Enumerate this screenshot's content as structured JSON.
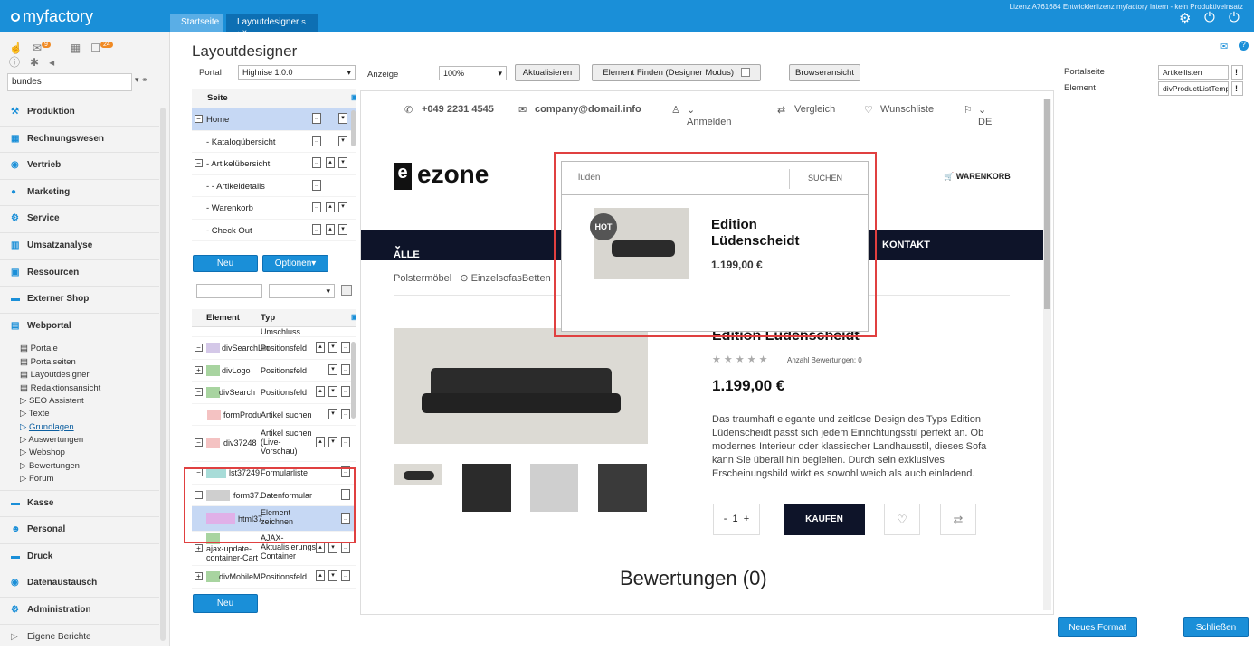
{
  "app": {
    "logo": "myfactory",
    "license": "Lizenz A761684 Entwicklerlizenz myfactory Intern - kein Produktiveinsatz"
  },
  "tabs": [
    {
      "label": "Startseite"
    },
    {
      "label": "Layoutdesigner"
    }
  ],
  "sidebar": {
    "search_value": "bundes",
    "badges": {
      "notes": "9",
      "messages": "24"
    },
    "items": [
      "Produktion",
      "Rechnungswesen",
      "Vertrieb",
      "Marketing",
      "Service",
      "Umsatzanalyse",
      "Ressourcen",
      "Externer Shop",
      "Webportal",
      "Kasse",
      "Personal",
      "Druck",
      "Datenaustausch",
      "Administration",
      "Eigene Berichte"
    ],
    "webportal_sub": [
      "Portale",
      "Portalseiten",
      "Layoutdesigner",
      "Redaktionsansicht",
      "SEO Assistent",
      "Texte",
      "Grundlagen",
      "Auswertungen",
      "Webshop",
      "Bewertungen",
      "Forum"
    ]
  },
  "page": {
    "title": "Layoutdesigner"
  },
  "toolbar": {
    "portal_label": "Portal",
    "portal_value": "Highrise 1.0.0",
    "anzeige_label": "Anzeige",
    "zoom_value": "100%",
    "refresh_label": "Aktualisieren",
    "find_label": "Element Finden (Designer Modus)",
    "browser_label": "Browseransicht"
  },
  "pages_tree": {
    "header": "Seite",
    "rows": [
      "Home",
      "- Katalogübersicht",
      "- Artikelübersicht",
      "- - Artikeldetails",
      "- Warenkorb",
      "- Check Out"
    ]
  },
  "page_buttons": {
    "new": "Neu",
    "options": "Optionen"
  },
  "elements": {
    "col_element": "Element",
    "col_typ": "Typ",
    "rows": [
      {
        "name": "divSearchLin",
        "typ": "Positionsfeld"
      },
      {
        "name": "divLogo",
        "typ": "Positionsfeld"
      },
      {
        "name": "divSearch",
        "typ": "Positionsfeld"
      },
      {
        "name": "formProdu",
        "typ": "Artikel suchen"
      },
      {
        "name": "div37248",
        "typ": "Artikel suchen (Live-Vorschau)"
      },
      {
        "name": "lst37249",
        "typ": "Formularliste"
      },
      {
        "name": "form37.",
        "typ": "Datenformular"
      },
      {
        "name": "html37.",
        "typ": "Element zeichnen"
      },
      {
        "name": "ajax-update-container-Cart",
        "typ": "AJAX-Aktualisierungs Container"
      },
      {
        "name": "divMobileM",
        "typ": "Positionsfeld"
      }
    ],
    "prev_typ": "Umschluss",
    "new": "Neu"
  },
  "properties": {
    "portalseite_label": "Portalseite",
    "portalseite_value": "Artikellisten",
    "element_label": "Element",
    "element_value": "divProductListTemp"
  },
  "preview": {
    "phone": "+049 2231 4545",
    "email": "company@domail.info",
    "login": "Anmelden",
    "compare": "Vergleich",
    "wishlist": "Wunschliste",
    "lang": "DE",
    "brand": "ezone",
    "search_value": "lüden",
    "search_button": "SUCHEN",
    "cart": "WARENKORB",
    "nav_cat": "ALLE KATEGORIEN",
    "nav_contact": "KONTAKT",
    "breadcrumb": [
      "Polstermöbel",
      "EinzelsofasBetten"
    ],
    "result": {
      "badge": "HOT",
      "name": "Edition Lüdenscheidt",
      "price": "1.199,00 €"
    },
    "product": {
      "title": "Edition Lüdenscheidt",
      "rating_label": "Anzahl Bewertungen: 0",
      "price": "1.199,00  €",
      "description": "Das traumhaft elegante und zeitlose Design des Typs Edition Lüdenscheidt passt sich jedem Einrichtungsstil perfekt an. Ob modernes Interieur oder klassischer Landhausstil, dieses Sofa kann Sie überall hin begleiten. Durch sein exklusives Erscheinungsbild wirkt es sowohl weich als auch einladend.",
      "qty": "1",
      "buy": "KAUFEN",
      "reviews": "Bewertungen (0)"
    }
  },
  "footer": {
    "new_format": "Neues Format",
    "close": "Schließen"
  },
  "colors": {
    "brand": "#1a8fd8",
    "nav": "#0e1429",
    "highlight": "#e04040"
  }
}
